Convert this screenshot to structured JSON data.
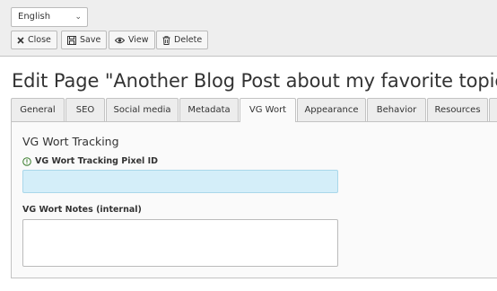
{
  "toolbar": {
    "language": "English",
    "close_label": "Close",
    "save_label": "Save",
    "view_label": "View",
    "delete_label": "Delete"
  },
  "page": {
    "title": "Edit Page \"Another Blog Post about my favorite topic\""
  },
  "tabs": [
    {
      "label": "General"
    },
    {
      "label": "SEO"
    },
    {
      "label": "Social media"
    },
    {
      "label": "Metadata"
    },
    {
      "label": "VG Wort",
      "active": true
    },
    {
      "label": "Appearance"
    },
    {
      "label": "Behavior"
    },
    {
      "label": "Resources"
    }
  ],
  "section": {
    "title": "VG Wort Tracking",
    "pixel_label": "VG Wort Tracking Pixel ID",
    "pixel_value": "",
    "notes_label": "VG Wort Notes (internal)",
    "notes_value": ""
  },
  "colors": {
    "input_highlight": "#d4eef9",
    "topbar": "#eeeeee",
    "panel": "#fafafa"
  }
}
